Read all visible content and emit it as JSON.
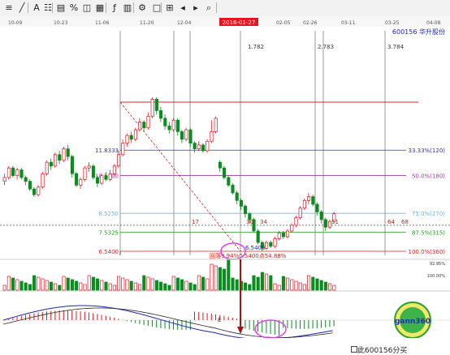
{
  "toolbar": {
    "buttons": [
      {
        "name": "stock-list-button",
        "label": "≡",
        "icon": "list-icon"
      },
      {
        "name": "draw-line-button",
        "label": "╱",
        "icon": "line-icon"
      },
      {
        "name": "text-button",
        "label": "A",
        "icon": "text-icon"
      },
      {
        "name": "compare-button",
        "label": "☷",
        "icon": "grid-icon"
      },
      {
        "name": "chart-type-button",
        "label": "▤",
        "icon": "bars-icon"
      },
      {
        "name": "percent-button",
        "label": "%",
        "icon": "percent-icon"
      },
      {
        "name": "scale-button",
        "label": "◫",
        "icon": "scale-icon"
      },
      {
        "name": "calendar-button",
        "label": "▦",
        "icon": "calendar-icon"
      },
      {
        "name": "formula-button",
        "label": "ƒ",
        "icon": "formula-icon"
      },
      {
        "name": "period-button",
        "label": "▥",
        "icon": "period-icon"
      },
      {
        "name": "settings-button",
        "label": "⚙",
        "icon": "gear-icon"
      },
      {
        "name": "window-button",
        "label": "□",
        "icon": "window-icon"
      },
      {
        "name": "tile-button",
        "label": "⊞",
        "icon": "tile-icon"
      },
      {
        "name": "prev-button",
        "label": "◂",
        "icon": "arrow-left-icon"
      },
      {
        "name": "next-button",
        "label": "▸",
        "icon": "arrow-right-icon"
      },
      {
        "name": "zoom-button",
        "label": "⌕",
        "icon": "zoom-icon"
      }
    ]
  },
  "stock": {
    "code": "600156",
    "name": "华升股份"
  },
  "dates": [
    "10-09",
    "10-23",
    "11-06",
    "11-20",
    "12-04",
    "02-05",
    "02-26",
    "03-11",
    "03-25",
    "04-08"
  ],
  "cursor_date": "2016-01-27",
  "time_markers": [
    "1.782",
    "2.783",
    "3.784"
  ],
  "price_levels": [
    "11.8333",
    "10.5100",
    "8.5250",
    "7.5325",
    "6.5400"
  ],
  "gann_levels": [
    "33.33%(120)",
    "50.0%(180)",
    "75.0%(270)",
    "87.5%(315)",
    "100.0%(360)"
  ],
  "low_label": "6.5400",
  "low_note": "回落9.94%0.5400点54.88%",
  "bar_counts": [
    "17",
    "30",
    "34",
    "51",
    "64",
    "68"
  ],
  "volume_scale": [
    "92.95%",
    "100.00%"
  ],
  "macd_annotation": "E",
  "logo_text": "gann360",
  "price_box": {
    "prefix": "此",
    "code": "600156",
    "suffix": "分买"
  },
  "colors": {
    "up": "#e6141e",
    "down": "#0a8c1e",
    "grid": "#d22828",
    "blue": "#1e28b4"
  },
  "chart_data": {
    "type": "candlestick",
    "note": "Daily candlestick chart with Gann retracement grid, volume and MACD panes",
    "y_axis_labels": [
      "11.8333",
      "10.5100",
      "8.5250",
      "7.5325",
      "6.5400"
    ],
    "retracement_levels": [
      {
        "price": 11.8333,
        "label": "33.33%(120)"
      },
      {
        "price": 10.51,
        "label": "50.0%(180)"
      },
      {
        "price": 8.525,
        "label": "75.0%(270)"
      },
      {
        "price": 7.5325,
        "label": "87.5%(315)"
      },
      {
        "price": 6.54,
        "label": "100.0%(360)"
      }
    ],
    "swing_high": 14.6,
    "swing_low": 6.54,
    "candles": [
      [
        10.2,
        10.4,
        10.6,
        10.0
      ],
      [
        10.4,
        10.9,
        11.0,
        10.3
      ],
      [
        10.9,
        10.5,
        11.0,
        10.4
      ],
      [
        10.5,
        10.8,
        10.9,
        10.3
      ],
      [
        10.8,
        10.4,
        10.9,
        10.3
      ],
      [
        10.4,
        10.2,
        10.5,
        10.0
      ],
      [
        10.2,
        9.8,
        10.3,
        9.7
      ],
      [
        9.8,
        9.5,
        9.9,
        9.4
      ],
      [
        9.5,
        9.9,
        10.0,
        9.4
      ],
      [
        9.9,
        10.6,
        10.7,
        9.8
      ],
      [
        10.6,
        11.2,
        11.3,
        10.5
      ],
      [
        11.2,
        11.0,
        11.4,
        10.8
      ],
      [
        11.0,
        11.6,
        11.7,
        10.9
      ],
      [
        11.6,
        11.3,
        11.8,
        11.1
      ],
      [
        11.3,
        11.9,
        12.0,
        11.2
      ],
      [
        11.9,
        11.5,
        12.1,
        11.3
      ],
      [
        11.5,
        10.6,
        11.6,
        10.4
      ],
      [
        10.6,
        10.0,
        10.7,
        9.9
      ],
      [
        10.0,
        10.3,
        10.4,
        9.8
      ],
      [
        10.3,
        10.9,
        11.0,
        10.2
      ],
      [
        10.9,
        11.0,
        11.2,
        10.7
      ],
      [
        11.0,
        10.4,
        11.1,
        10.3
      ],
      [
        10.4,
        10.1,
        10.5,
        9.9
      ],
      [
        10.1,
        10.5,
        10.6,
        10.0
      ],
      [
        10.5,
        10.3,
        10.7,
        10.2
      ],
      [
        10.3,
        10.6,
        10.8,
        10.2
      ],
      [
        10.6,
        11.0,
        11.1,
        10.5
      ],
      [
        11.0,
        11.6,
        11.8,
        10.9
      ],
      [
        11.6,
        12.2,
        12.4,
        11.5
      ],
      [
        12.2,
        12.6,
        12.7,
        12.0
      ],
      [
        12.6,
        12.4,
        12.8,
        12.2
      ],
      [
        12.4,
        12.9,
        13.0,
        12.3
      ],
      [
        12.9,
        13.3,
        13.5,
        12.8
      ],
      [
        13.3,
        13.0,
        13.4,
        12.8
      ],
      [
        13.0,
        13.6,
        13.8,
        12.9
      ],
      [
        13.6,
        14.5,
        14.6,
        13.5
      ],
      [
        14.5,
        13.9,
        14.6,
        13.7
      ],
      [
        13.9,
        13.5,
        14.1,
        13.3
      ],
      [
        13.5,
        13.1,
        13.7,
        12.9
      ],
      [
        13.1,
        12.9,
        13.3,
        12.7
      ],
      [
        12.9,
        13.4,
        13.5,
        12.8
      ],
      [
        13.4,
        12.8,
        13.5,
        12.6
      ],
      [
        12.8,
        12.4,
        12.9,
        12.2
      ],
      [
        12.4,
        12.9,
        13.0,
        12.3
      ],
      [
        12.9,
        12.2,
        13.0,
        12.0
      ],
      [
        12.2,
        11.9,
        12.3,
        11.7
      ],
      [
        11.9,
        12.1,
        12.3,
        11.8
      ],
      [
        12.1,
        11.8,
        12.2,
        11.7
      ],
      [
        11.8,
        12.3,
        12.4,
        11.7
      ],
      [
        12.3,
        12.8,
        13.4,
        12.2
      ],
      [
        12.8,
        13.5,
        13.6,
        12.7
      ],
      [
        11.2,
        10.9,
        11.3,
        10.7
      ],
      [
        10.9,
        10.4,
        11.0,
        10.3
      ],
      [
        10.4,
        10.0,
        10.5,
        9.9
      ],
      [
        10.0,
        9.6,
        10.1,
        9.5
      ],
      [
        9.6,
        9.2,
        9.7,
        9.0
      ],
      [
        9.2,
        8.9,
        9.3,
        8.7
      ],
      [
        8.9,
        8.5,
        9.0,
        8.3
      ],
      [
        8.5,
        8.2,
        8.6,
        8.0
      ],
      [
        8.2,
        7.6,
        8.3,
        7.5
      ],
      [
        7.6,
        7.0,
        7.7,
        6.9
      ],
      [
        7.0,
        6.7,
        7.1,
        6.54
      ],
      [
        6.7,
        7.0,
        7.1,
        6.6
      ],
      [
        7.0,
        6.8,
        7.1,
        6.7
      ],
      [
        6.8,
        7.2,
        7.3,
        6.7
      ],
      [
        7.2,
        7.5,
        7.6,
        7.1
      ],
      [
        7.5,
        7.3,
        7.6,
        7.2
      ],
      [
        7.3,
        7.6,
        7.7,
        7.2
      ],
      [
        7.6,
        7.9,
        8.0,
        7.5
      ],
      [
        7.9,
        8.3,
        8.4,
        7.8
      ],
      [
        8.3,
        8.8,
        8.9,
        8.2
      ],
      [
        8.8,
        9.2,
        9.3,
        8.7
      ],
      [
        9.2,
        9.4,
        9.6,
        9.0
      ],
      [
        9.4,
        9.0,
        9.5,
        8.9
      ],
      [
        9.0,
        8.6,
        9.1,
        8.4
      ],
      [
        8.6,
        8.2,
        8.7,
        8.0
      ],
      [
        8.2,
        7.8,
        8.3,
        7.6
      ],
      [
        7.8,
        8.1,
        8.2,
        7.7
      ],
      [
        8.1,
        8.5,
        8.6,
        8.0
      ]
    ]
  }
}
